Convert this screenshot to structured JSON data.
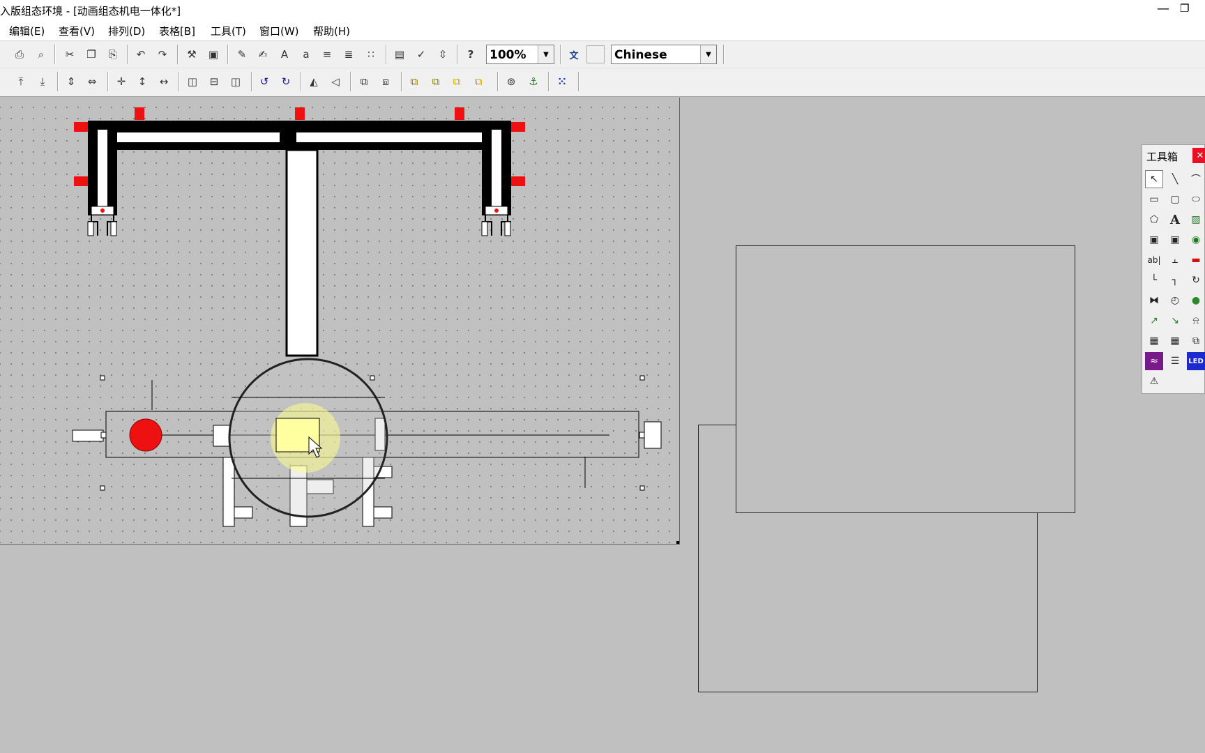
{
  "window": {
    "title": "入版组态环境 - [动画组态机电一体化*]",
    "minimize_symbol": "—",
    "restore_symbol": "❐"
  },
  "menu": [
    {
      "label": "编辑(E)"
    },
    {
      "label": "查看(V)"
    },
    {
      "label": "排列(D)"
    },
    {
      "label": "表格[B]"
    },
    {
      "label": "工具(T)"
    },
    {
      "label": "窗口(W)"
    },
    {
      "label": "帮助(H)"
    }
  ],
  "toolbar": {
    "zoom": {
      "value": "100%",
      "dropdown_symbol": "▼"
    },
    "language": {
      "value": "Chinese",
      "dropdown_symbol": "▼"
    },
    "buttons": [
      {
        "icon": "print-icon",
        "glyph": "⎙"
      },
      {
        "icon": "print-preview-icon",
        "glyph": "⌕"
      },
      {
        "icon": "cut-icon",
        "glyph": "✂"
      },
      {
        "icon": "copy-icon",
        "glyph": "❐"
      },
      {
        "icon": "paste-icon",
        "glyph": "⎘"
      },
      {
        "icon": "undo-icon",
        "glyph": "↶"
      },
      {
        "icon": "redo-icon",
        "glyph": "↷"
      },
      {
        "icon": "tools-icon",
        "glyph": "⚒"
      },
      {
        "icon": "window-properties-icon",
        "glyph": "▣"
      },
      {
        "icon": "edit-properties-icon",
        "glyph": "✎"
      },
      {
        "icon": "edit-script-icon",
        "glyph": "✍"
      },
      {
        "icon": "font-icon",
        "glyph": "A"
      },
      {
        "icon": "font-size-icon",
        "glyph": "a"
      },
      {
        "icon": "line-style-icon",
        "glyph": "≡"
      },
      {
        "icon": "align-icon",
        "glyph": "≣"
      },
      {
        "icon": "grid-icon",
        "glyph": "∷"
      },
      {
        "icon": "data-object-icon",
        "glyph": "▤"
      },
      {
        "icon": "check-icon",
        "glyph": "✓"
      },
      {
        "icon": "sort-icon",
        "glyph": "⇳"
      },
      {
        "icon": "help-icon",
        "glyph": "?"
      }
    ],
    "after_zoom_buttons": [
      {
        "icon": "language-switch-icon",
        "glyph": "文"
      },
      {
        "icon": "blank-button-icon",
        "glyph": ""
      }
    ],
    "layout_buttons": [
      {
        "icon": "align-top-icon",
        "glyph": "⤒"
      },
      {
        "icon": "align-bottom-icon",
        "glyph": "⤓"
      },
      {
        "icon": "same-height-icon",
        "glyph": "⇕"
      },
      {
        "icon": "same-width-icon",
        "glyph": "⇔"
      },
      {
        "icon": "center-icon",
        "glyph": "✛"
      },
      {
        "icon": "center-vertical-icon",
        "glyph": "↕"
      },
      {
        "icon": "center-horizontal-icon",
        "glyph": "↔"
      },
      {
        "icon": "distribute-left-icon",
        "glyph": "◫"
      },
      {
        "icon": "distribute-center-icon",
        "glyph": "⊟"
      },
      {
        "icon": "distribute-right-icon",
        "glyph": "◫"
      },
      {
        "icon": "rotate-left-icon",
        "glyph": "↺"
      },
      {
        "icon": "rotate-right-icon",
        "glyph": "↻"
      },
      {
        "icon": "flip-horizontal-icon",
        "glyph": "◭"
      },
      {
        "icon": "flip-vertical-icon",
        "glyph": "◁"
      },
      {
        "icon": "group-icon",
        "glyph": "⧉"
      },
      {
        "icon": "ungroup-icon",
        "glyph": "⧈"
      },
      {
        "icon": "bring-front-icon",
        "glyph": "⧉"
      },
      {
        "icon": "send-back-icon",
        "glyph": "⧉"
      },
      {
        "icon": "bring-forward-icon",
        "glyph": "⧉"
      },
      {
        "icon": "send-backward-icon",
        "glyph": "⧉"
      },
      {
        "icon": "lock-icon",
        "glyph": "⊚"
      },
      {
        "icon": "anchor-icon",
        "glyph": "⚓"
      },
      {
        "icon": "grid-dots-icon",
        "glyph": "⁙"
      }
    ]
  },
  "toolbox": {
    "title": "工具箱",
    "close_symbol": "✕",
    "tools": [
      {
        "icon": "pointer-icon",
        "glyph": "↖"
      },
      {
        "icon": "line-icon",
        "glyph": "╲"
      },
      {
        "icon": "arc-icon",
        "glyph": "⌒"
      },
      {
        "icon": "rectangle-icon",
        "glyph": "▭"
      },
      {
        "icon": "rounded-rectangle-icon",
        "glyph": "▢"
      },
      {
        "icon": "ellipse-icon",
        "glyph": "⬭"
      },
      {
        "icon": "polygon-icon",
        "glyph": "⬠"
      },
      {
        "icon": "label-icon",
        "glyph": "A"
      },
      {
        "icon": "bitmap-icon",
        "glyph": "▨"
      },
      {
        "icon": "standard-button-icon",
        "glyph": "▣"
      },
      {
        "icon": "dynamic-button-icon",
        "glyph": "▣"
      },
      {
        "icon": "component-library-icon",
        "glyph": "◉"
      },
      {
        "icon": "input-box-icon",
        "glyph": "ab|"
      },
      {
        "icon": "slider-icon",
        "glyph": "⫠"
      },
      {
        "icon": "bar-icon",
        "glyph": "▬"
      },
      {
        "icon": "pipe-icon",
        "glyph": "└"
      },
      {
        "icon": "flow-icon",
        "glyph": "┐"
      },
      {
        "icon": "rotate-icon",
        "glyph": "↻"
      },
      {
        "icon": "valve-icon",
        "glyph": "⧓"
      },
      {
        "icon": "gauge-icon",
        "glyph": "◴"
      },
      {
        "icon": "indicator-icon",
        "glyph": "●"
      },
      {
        "icon": "trend-icon",
        "glyph": "↗"
      },
      {
        "icon": "history-trend-icon",
        "glyph": "↘"
      },
      {
        "icon": "alarm-icon",
        "glyph": "⍾"
      },
      {
        "icon": "table-icon",
        "glyph": "▦"
      },
      {
        "icon": "report-icon",
        "glyph": "▦"
      },
      {
        "icon": "window-icon",
        "glyph": "⧉"
      },
      {
        "icon": "chart-icon",
        "glyph": "≈"
      },
      {
        "icon": "list-icon",
        "glyph": "☰"
      },
      {
        "icon": "led-icon",
        "glyph": "LED"
      },
      {
        "icon": "media-icon",
        "glyph": "⚠"
      }
    ]
  },
  "canvas": {
    "grid_dots": true,
    "background": "#c0c0c0",
    "accent_red": "#ee1111",
    "highlight_yellow": "#ffffa0"
  }
}
